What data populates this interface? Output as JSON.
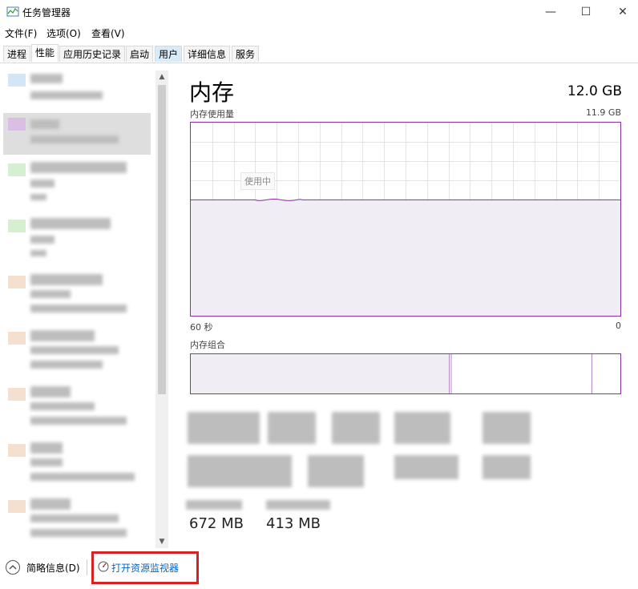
{
  "window": {
    "title": "任务管理器",
    "controls": {
      "minimize": "—",
      "maximize": "☐",
      "close": "✕"
    }
  },
  "menu": {
    "items": [
      "文件(F)",
      "选项(O)",
      "查看(V)"
    ]
  },
  "tabs": [
    {
      "label": "进程"
    },
    {
      "label": "性能"
    },
    {
      "label": "应用历史记录"
    },
    {
      "label": "启动"
    },
    {
      "label": "用户"
    },
    {
      "label": "详细信息"
    },
    {
      "label": "服务"
    }
  ],
  "memory": {
    "title": "内存",
    "capacity": "12.0 GB",
    "usage_label": "内存使用量",
    "usage_max": "11.9 GB",
    "graph_overlay_label": "使用中",
    "time_left": "60 秒",
    "time_right": "0",
    "composition_label": "内存组合",
    "bottom_values": [
      "672 MB",
      "413 MB"
    ],
    "used_fraction": 0.6,
    "composition_used_fraction": 0.6
  },
  "footer": {
    "fewer_details": "简略信息(D)",
    "open_resource_monitor": "打开资源监视器"
  },
  "colors": {
    "memory_accent": "#8b2fa7",
    "memory_fill": "#f1edf4",
    "link": "#0066cc",
    "highlight": "#d62222"
  },
  "icons": {
    "app": "task-manager-icon",
    "monitor": "resource-monitor-icon",
    "collapse": "chevron-up-circle-icon"
  }
}
